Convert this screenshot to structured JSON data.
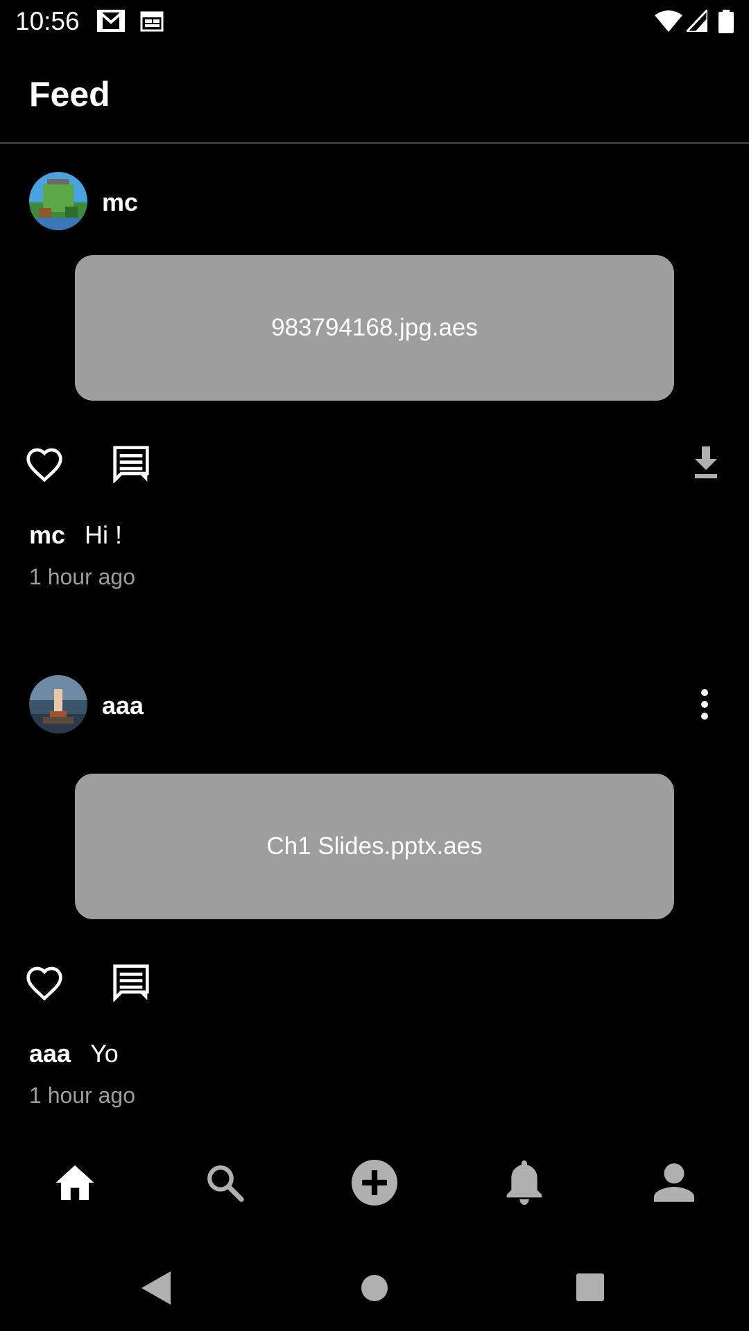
{
  "status_bar": {
    "time": "10:56",
    "icons": [
      "gmail-icon",
      "calendar-icon",
      "wifi-icon",
      "signal-icon",
      "battery-icon"
    ]
  },
  "app_bar": {
    "title": "Feed"
  },
  "posts": [
    {
      "username": "mc",
      "file_name": "983794168.jpg.aes",
      "caption_user": "mc",
      "caption_text": "Hi !",
      "time": "1 hour ago",
      "actions": [
        "like-icon",
        "comment-icon",
        "download-icon"
      ]
    },
    {
      "username": "aaa",
      "file_name": "Ch1 Slides.pptx.aes",
      "caption_user": "aaa",
      "caption_text": "Yo",
      "time": "1 hour ago",
      "actions": [
        "like-icon",
        "comment-icon",
        "more-options-icon"
      ]
    }
  ],
  "bottom_nav": {
    "items": [
      "home-icon",
      "search-icon",
      "add-post-icon",
      "notifications-icon",
      "profile-icon"
    ],
    "active": "home-icon"
  },
  "system_nav": {
    "items": [
      "back-icon",
      "home-circle-icon",
      "recents-icon"
    ]
  },
  "colors": {
    "background": "#000000",
    "card": "#9e9e9e",
    "secondary_text": "#9e9e9e",
    "divider": "#3a3a3a",
    "inactive_icon": "#b0b0b0"
  }
}
